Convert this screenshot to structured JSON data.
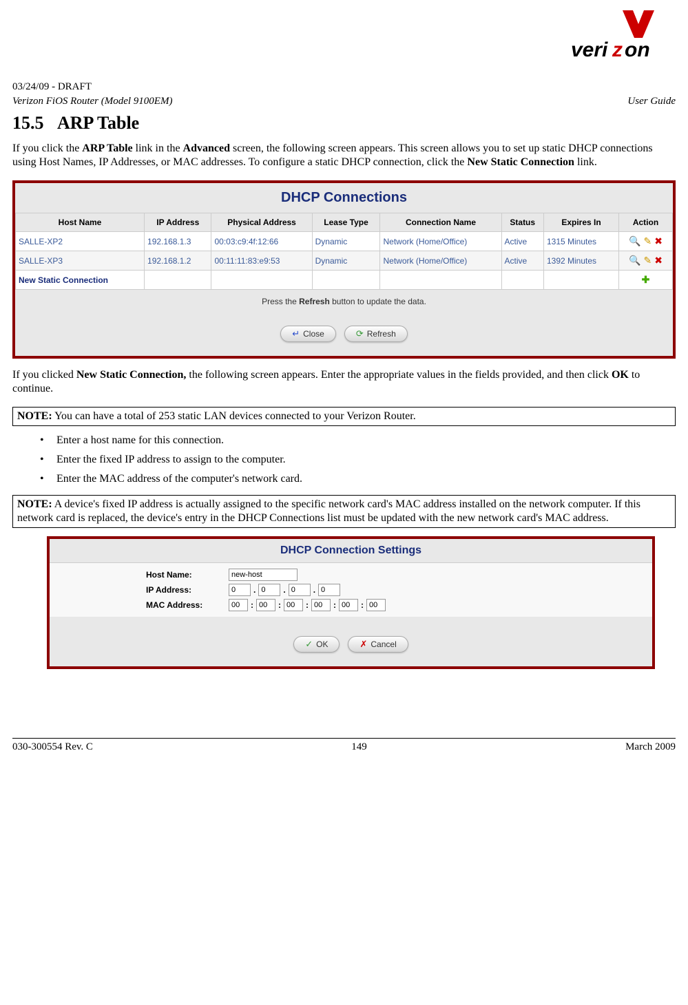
{
  "header": {
    "draft_line": "03/24/09 - DRAFT",
    "product": "Verizon FiOS Router (Model 9100EM)",
    "doc_type": "User Guide"
  },
  "section": {
    "number": "15.5",
    "title": "ARP Table"
  },
  "para1": {
    "p1": "If you click the ",
    "b1": "ARP Table",
    "p2": " link in the ",
    "b2": "Advanced",
    "p3": " screen, the following screen appears. This screen allows you to set up static DHCP connections using Host Names, IP Addresses, or MAC addresses. To configure a static DHCP connection, click the ",
    "b3": "New Static Connection",
    "p4": " link."
  },
  "dhcp_connections": {
    "title": "DHCP Connections",
    "headers": [
      "Host Name",
      "IP Address",
      "Physical Address",
      "Lease Type",
      "Connection Name",
      "Status",
      "Expires In",
      "Action"
    ],
    "rows": [
      {
        "host": "SALLE-XP2",
        "ip": "192.168.1.3",
        "mac": "00:03:c9:4f:12:66",
        "lease": "Dynamic",
        "conn": "Network (Home/Office)",
        "status": "Active",
        "expires": "1315 Minutes"
      },
      {
        "host": "SALLE-XP3",
        "ip": "192.168.1.2",
        "mac": "00:11:11:83:e9:53",
        "lease": "Dynamic",
        "conn": "Network (Home/Office)",
        "status": "Active",
        "expires": "1392 Minutes"
      }
    ],
    "new_static_link": "New Static Connection",
    "refresh_msg_pre": "Press the ",
    "refresh_msg_bold": "Refresh",
    "refresh_msg_post": " button to update the data.",
    "btn_close": "Close",
    "btn_refresh": "Refresh"
  },
  "para2": {
    "p1": "If you clicked ",
    "b1": "New Static Connection,",
    "p2": " the following screen appears. Enter the appropriate values in the fields provided, and then click ",
    "b2": "OK",
    "p3": " to continue."
  },
  "note1": {
    "label": "NOTE:",
    "text": " You can have a total of 253 static LAN devices connected to your Verizon Router."
  },
  "bullets": [
    "Enter a host name for this connection.",
    "Enter the fixed IP address to assign to the computer.",
    "Enter the MAC address of the computer's network card."
  ],
  "note2": {
    "label": "NOTE:",
    "text": " A device's fixed IP address is actually assigned to the specific network card's MAC address installed on the network computer. If this network card is replaced, the device's entry in the DHCP Connections list must be updated with the new network card's MAC address."
  },
  "dhcp_settings": {
    "title": "DHCP Connection Settings",
    "labels": {
      "host": "Host Name:",
      "ip": "IP Address:",
      "mac": "MAC Address:"
    },
    "host_value": "new-host",
    "ip": [
      "0",
      "0",
      "0",
      "0"
    ],
    "mac": [
      "00",
      "00",
      "00",
      "00",
      "00",
      "00"
    ],
    "btn_ok": "OK",
    "btn_cancel": "Cancel"
  },
  "footer": {
    "left": "030-300554 Rev. C",
    "center": "149",
    "right": "March 2009"
  }
}
